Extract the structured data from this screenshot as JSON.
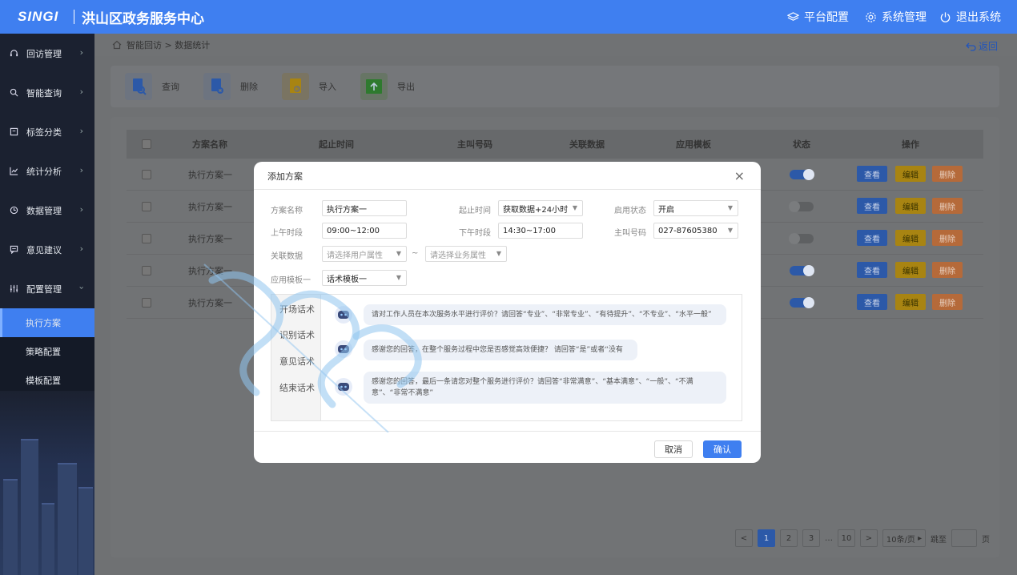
{
  "header": {
    "logo": "SINGI",
    "title": "洪山区政务服务中心",
    "nav": [
      {
        "label": "平台配置",
        "icon": "layers-icon"
      },
      {
        "label": "系统管理",
        "icon": "gear-icon"
      },
      {
        "label": "退出系统",
        "icon": "power-icon"
      }
    ]
  },
  "sidebar": {
    "items": [
      {
        "label": "回访管理",
        "icon": "headset-icon"
      },
      {
        "label": "智能查询",
        "icon": "search-icon"
      },
      {
        "label": "标签分类",
        "icon": "tag-icon"
      },
      {
        "label": "统计分析",
        "icon": "chart-icon"
      },
      {
        "label": "数据管理",
        "icon": "clock-icon"
      },
      {
        "label": "意见建议",
        "icon": "message-icon"
      },
      {
        "label": "配置管理",
        "icon": "sliders-icon"
      }
    ],
    "sub_items": [
      "执行方案",
      "策略配置",
      "模板配置"
    ],
    "active_sub": "执行方案"
  },
  "breadcrumb": {
    "text": "智能回访 > 数据统计",
    "back": "返回"
  },
  "toolbar": {
    "query": "查询",
    "delete": "删除",
    "import": "导入",
    "export": "导出"
  },
  "table": {
    "headers": [
      "方案名称",
      "起止时间",
      "主叫号码",
      "关联数据",
      "应用模板",
      "状态",
      "操作"
    ],
    "rows": [
      {
        "name": "执行方案一",
        "on": true
      },
      {
        "name": "执行方案一",
        "on": false
      },
      {
        "name": "执行方案一",
        "on": false
      },
      {
        "name": "执行方案一",
        "on": true
      },
      {
        "name": "执行方案一",
        "on": true
      }
    ],
    "actions": {
      "view": "查看",
      "edit": "编辑",
      "delete": "删除"
    }
  },
  "pagination": {
    "prev": "<",
    "pages": [
      "1",
      "2",
      "3"
    ],
    "ellipsis": "…",
    "last": "10",
    "next": ">",
    "per_page": "10条/页",
    "jump_label": "跳至",
    "page_suffix": "页",
    "current": 1
  },
  "modal": {
    "title": "添加方案",
    "close": "×",
    "fields": {
      "name_label": "方案名称",
      "name_value": "执行方案一",
      "period_label": "起止时间",
      "period_value": "获取数据+24小时",
      "status_label": "启用状态",
      "status_value": "开启",
      "am_label": "上午时段",
      "am_value": "09:00~12:00",
      "pm_label": "下午时段",
      "pm_value": "14:30~17:00",
      "caller_label": "主叫号码",
      "caller_value": "027-87605380",
      "related_label": "关联数据",
      "user_attr_placeholder": "请选择用户属性",
      "tilde": "~",
      "biz_attr_placeholder": "请选择业务属性",
      "template_label": "应用模板一",
      "template_value": "话术模板一"
    },
    "chat_tabs": [
      "开场话术",
      "识别话术",
      "意见话术",
      "结束话术"
    ],
    "messages": [
      "请对工作人员在本次服务水平进行评价？请回答“专业”、“非常专业”、“有待提升”、“不专业”、“水平一般”",
      "感谢您的回答，在整个服务过程中您是否感觉高效便捷？ 请回答“是”或者“没有",
      "感谢您的回答，最后一条请您对整个服务进行评价？请回答“非常满意”、“基本满意”、“一般”、“不满意”、“非常不满意”"
    ],
    "cancel": "取消",
    "confirm": "确认"
  },
  "colors": {
    "primary": "#3f7ff0",
    "sidebar": "#1b2130",
    "edit": "#f5b800",
    "delete": "#f08a45"
  }
}
